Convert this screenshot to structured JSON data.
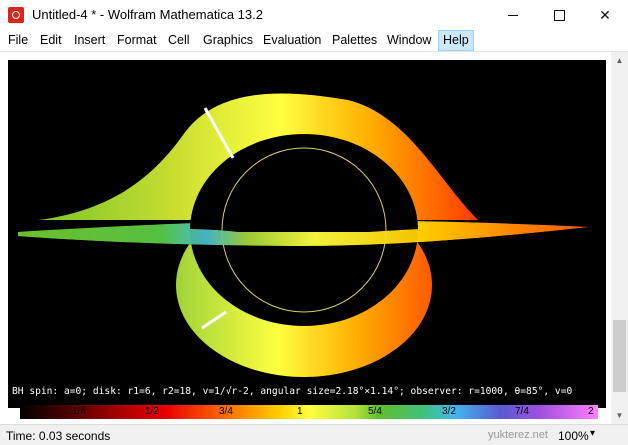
{
  "window": {
    "title": "Untitled-4 * - Wolfram Mathematica 13.2"
  },
  "menu": [
    "File",
    "Edit",
    "Insert",
    "Format",
    "Cell",
    "Graphics",
    "Evaluation",
    "Palettes",
    "Window",
    "Help"
  ],
  "graphic": {
    "caption": "BH spin: a=0; disk: r1=6, r2=18, v=1/√r-2, angular size=2.18°×1.14°; observer: r=1000, θ=85°, v=0",
    "ticks": [
      "1/4",
      "1/2",
      "3/4",
      "1",
      "5/4",
      "3/2",
      "7/4",
      "2"
    ]
  },
  "status": {
    "time": "Time: 0.03 seconds",
    "watermark": "yukterez.net",
    "zoom": "100%"
  },
  "colors": {
    "background": "#000000",
    "ring_gradient": [
      "#5fbf2a",
      "#ffff40",
      "#ffd000",
      "#ff7a00",
      "#e60000"
    ]
  },
  "icons": {
    "app": "mathematica-icon",
    "zoom_dropdown": "chevron-down-icon"
  }
}
